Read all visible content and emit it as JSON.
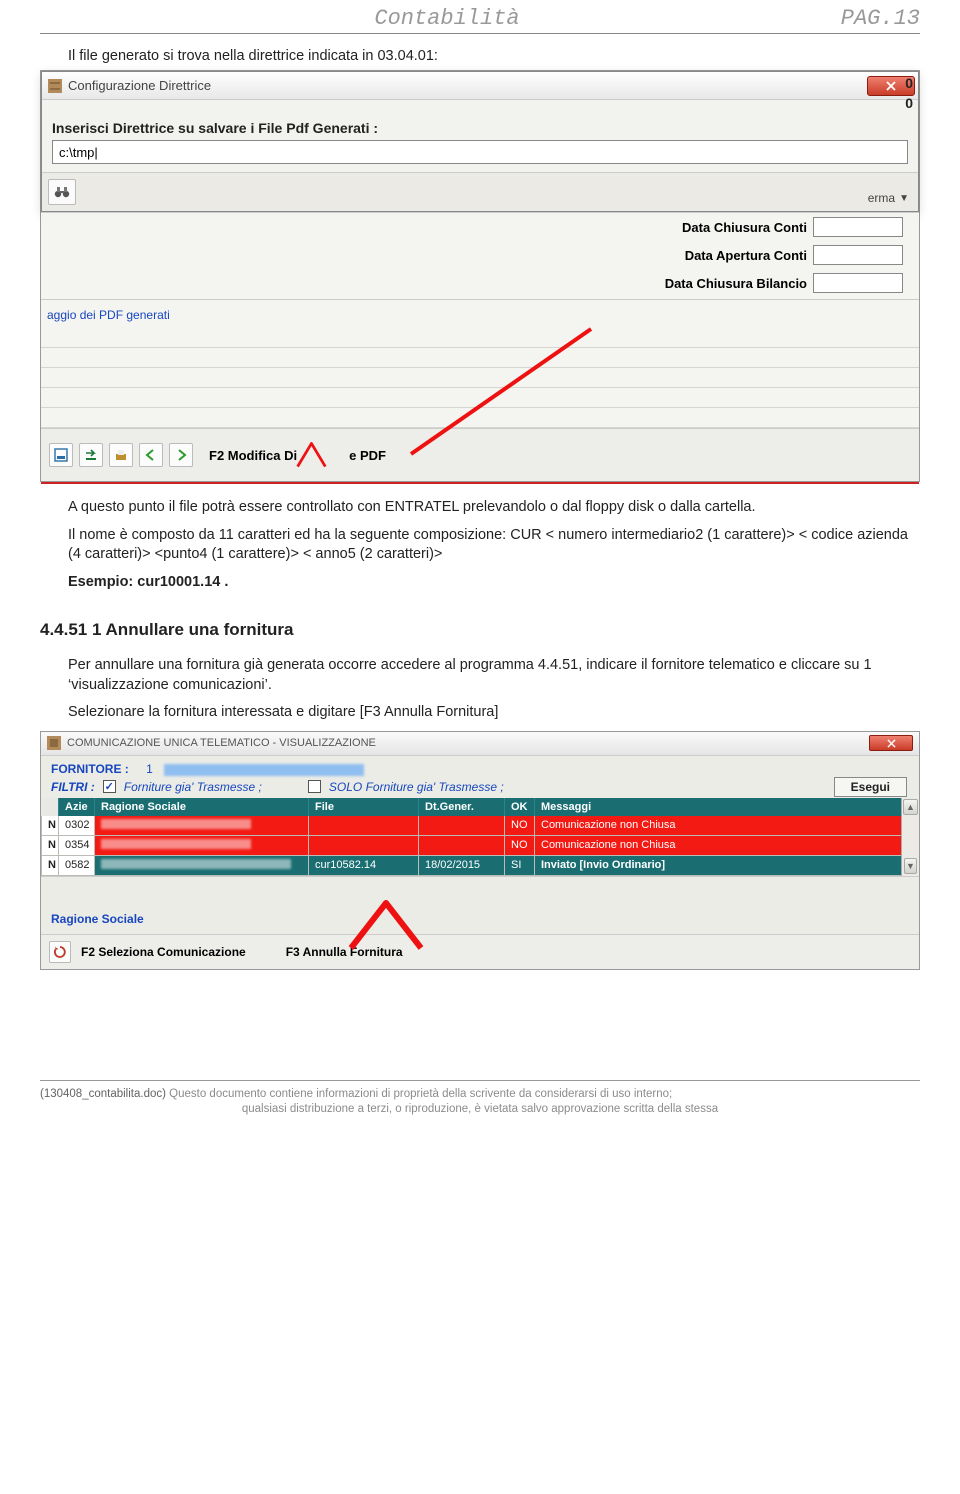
{
  "header": {
    "title": "Contabilità",
    "page": "PAG.13"
  },
  "intro": "Il file generato si trova nella direttrice indicata in 03.04.01:",
  "dialog": {
    "title": "Configurazione Direttrice",
    "right_zeros": [
      "0",
      "0"
    ],
    "prompt": "Inserisci Direttrice su salvare i File Pdf Generati :",
    "path_value": "c:\\tmp|",
    "erma": "erma",
    "row1": "Data Chiusura Conti",
    "row2": "Data Apertura Conti",
    "row3": "Data Chiusura Bilancio",
    "pdf_gen": "aggio dei PDF generati",
    "f2": "F2 Modifica Di",
    "f2_tail": "e PDF"
  },
  "para1_a": "A questo punto il file potrà essere controllato con ENTRATEL prelevandolo o dal floppy disk o dalla cartella.",
  "para1_b": "Il nome è composto da 11 caratteri ed ha la seguente composizione: CUR < numero intermediario2 (1 carattere)> < codice azienda (4 caratteri)> <punto4 (1 carattere)> < anno5 (2 caratteri)>",
  "para1_c": "Esempio: cur10001.14 .",
  "h3": "4.4.51 1 Annullare una fornitura",
  "para2_a": "Per annullare una fornitura già generata occorre accedere al programma 4.4.51, indicare il fornitore telematico e cliccare su 1 ‘visualizzazione comunicazioni’.",
  "para2_b": "Selezionare la fornitura interessata e digitare [F3 Annulla Fornitura]",
  "win2": {
    "title": "COMUNICAZIONE UNICA TELEMATICO  - VISUALIZZAZIONE",
    "fornitore_k": "FORNITORE :",
    "fornitore_v": "1",
    "filtri": "FILTRI :",
    "opt1": "Forniture gia' Trasmesse ;",
    "opt2": "SOLO Forniture gia' Trasmesse ;",
    "esegui": "Esegui",
    "cols": [
      "Azie",
      "Ragione Sociale",
      "File",
      "Dt.Gener.",
      "OK",
      "Messaggi"
    ],
    "rows": [
      {
        "tag": "N",
        "azie": "0302",
        "file": "",
        "dt": "",
        "ok": "NO",
        "msg": "Comunicazione non Chiusa",
        "kind": "red"
      },
      {
        "tag": "N",
        "azie": "0354",
        "file": "",
        "dt": "",
        "ok": "NO",
        "msg": "Comunicazione non Chiusa",
        "kind": "red"
      },
      {
        "tag": "N",
        "azie": "0582",
        "file": "cur10582.14",
        "dt": "18/02/2015",
        "ok": "SI",
        "msg": "Inviato [Invio Ordinario]",
        "kind": "teal"
      }
    ],
    "ragione": "Ragione Sociale",
    "f2": "F2 Seleziona Comunicazione",
    "f3": "F3 Annulla Fornitura"
  },
  "footer": {
    "fname": "(130408_contabilita.doc)",
    "l1": " Questo documento contiene informazioni di proprietà della scrivente da considerarsi  di uso interno;",
    "l2": "qualsiasi distribuzione a terzi, o riproduzione, è vietata salvo approvazione scritta della stessa"
  }
}
